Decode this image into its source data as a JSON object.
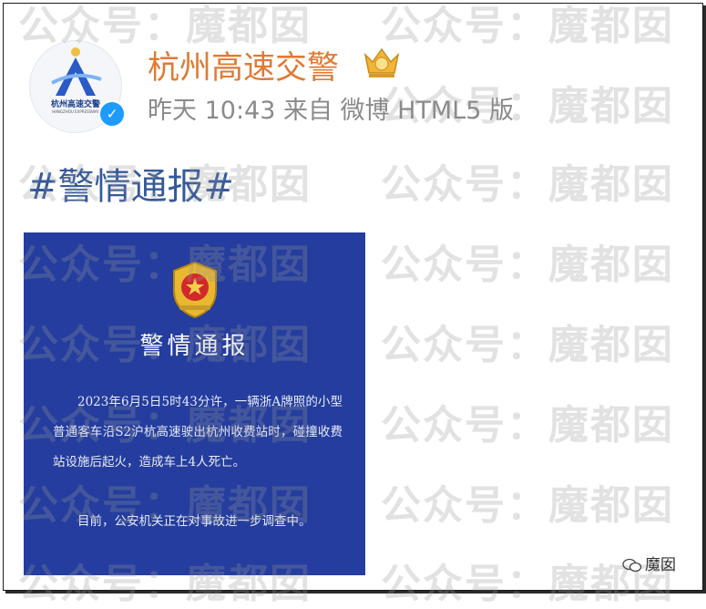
{
  "post": {
    "username": "杭州高速交警",
    "meta": "昨天 10:43 来自 微博 HTML5 版",
    "hashtag": "#警情通报#"
  },
  "avatar": {
    "text": "杭州高速交警",
    "sub": "HANGZHOU EXPRESSWAY"
  },
  "verified_icon": "verified-check",
  "notice": {
    "title": "警情通报",
    "paragraph1": "2023年6月5日5时43分许，一辆浙A牌照的小型普通客车沿S2沪杭高速驶出杭州收费站时，碰撞收费站设施后起火，造成车上4人死亡。",
    "paragraph2": "目前，公安机关正在对事故进一步调查中。"
  },
  "watermark": {
    "a": "公众号：",
    "b": "魔都囡"
  },
  "footer": {
    "label": "魔囡"
  },
  "colors": {
    "username": "#e07a34",
    "hashtag": "#355a9a",
    "notice_bg": "#243d9e",
    "verified": "#1e9bff"
  }
}
